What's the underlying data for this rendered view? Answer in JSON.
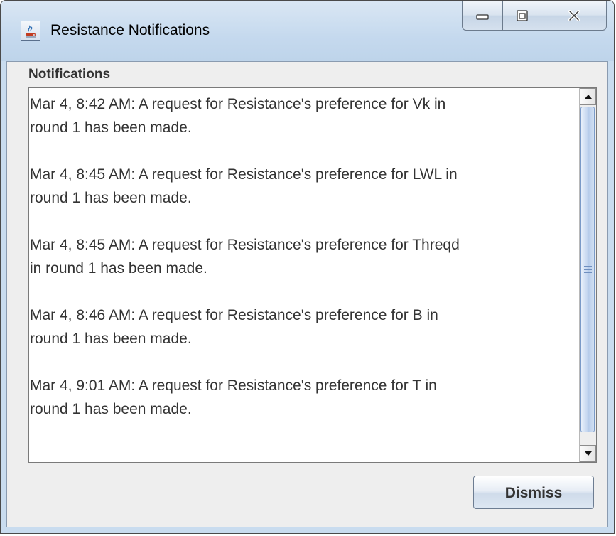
{
  "window": {
    "title": "Resistance Notifications",
    "icon": "java-app-icon",
    "caption_buttons": [
      "minimize-icon",
      "maximize-icon",
      "close-icon"
    ]
  },
  "notifications": {
    "heading": "Notifications",
    "messages": [
      "Mar 4, 8:42 AM: A request for Resistance's preference for Vk in\nround 1 has been made.",
      "Mar 4, 8:45 AM: A request for Resistance's preference for LWL in\nround 1 has been made.",
      "Mar 4, 8:45 AM: A request for Resistance's preference for Threqd\nin round 1 has been made.",
      "Mar 4, 8:46 AM: A request for Resistance's preference for B in\nround 1 has been made.",
      "Mar 4, 9:01 AM: A request for Resistance's preference for T in\nround 1 has been made."
    ]
  },
  "actions": {
    "dismiss_label": "Dismiss"
  },
  "colors": {
    "titlebar": "#c5d9ee",
    "client_bg": "#eeeeee",
    "text": "#333333",
    "scroll_thumb": "#b5cbea"
  }
}
